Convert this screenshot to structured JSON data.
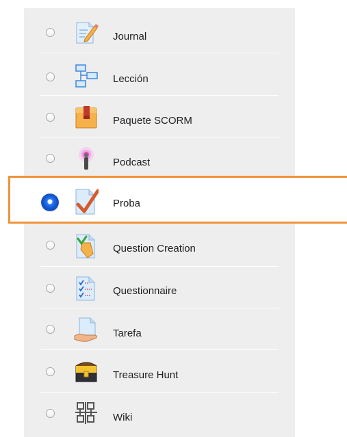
{
  "activities": [
    {
      "label": "Journal",
      "icon": "journal-icon",
      "selected": false
    },
    {
      "label": "Lección",
      "icon": "lesson-icon",
      "selected": false
    },
    {
      "label": "Paquete SCORM",
      "icon": "scorm-package-icon",
      "selected": false
    },
    {
      "label": "Podcast",
      "icon": "podcast-icon",
      "selected": false
    },
    {
      "label": "Proba",
      "icon": "quiz-icon",
      "selected": true
    },
    {
      "label": "Question Creation",
      "icon": "question-creation-icon",
      "selected": false
    },
    {
      "label": "Questionnaire",
      "icon": "questionnaire-icon",
      "selected": false
    },
    {
      "label": "Tarefa",
      "icon": "assignment-icon",
      "selected": false
    },
    {
      "label": "Treasure Hunt",
      "icon": "treasure-hunt-icon",
      "selected": false
    },
    {
      "label": "Wiki",
      "icon": "wiki-icon",
      "selected": false
    }
  ],
  "colors": {
    "highlight_border": "#f0933a",
    "panel_background": "#eeeeee",
    "radio_selected": "#1459d6"
  }
}
